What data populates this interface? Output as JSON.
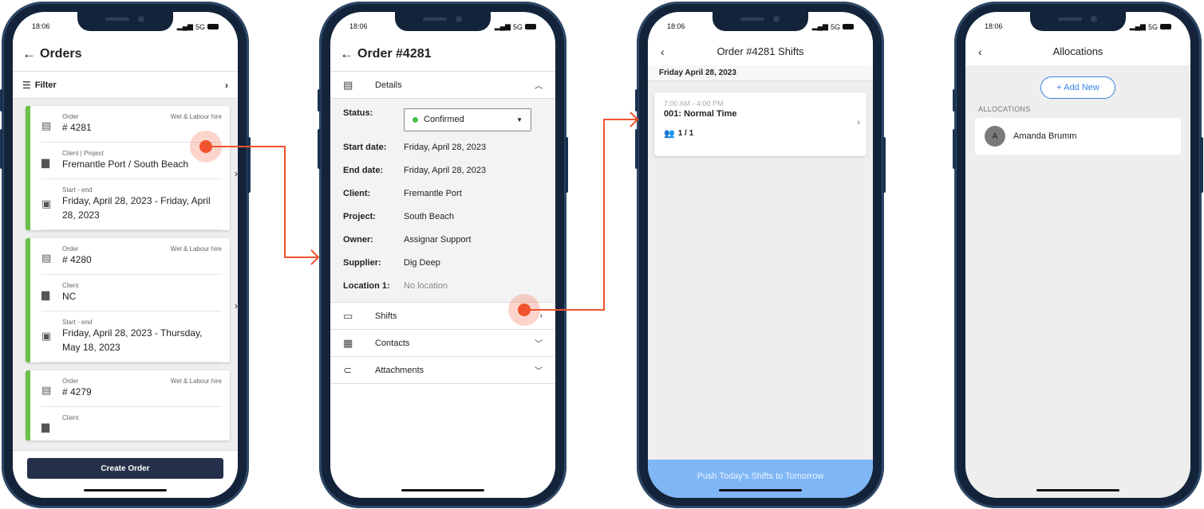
{
  "status": {
    "time": "18:06",
    "network": "5G"
  },
  "screen1": {
    "title": "Orders",
    "filter_label": "Filter",
    "create_button": "Create Order",
    "orders": [
      {
        "order_label": "Order",
        "order_number": "# 4281",
        "type": "Wet & Labour hire",
        "client_label": "Client | Project",
        "client": "Fremantle Port / South Beach",
        "dates_label": "Start - end",
        "dates": "Friday, April 28, 2023 - Friday, April 28, 2023"
      },
      {
        "order_label": "Order",
        "order_number": "# 4280",
        "type": "Wet & Labour hire",
        "client_label": "Client",
        "client": "NC",
        "dates_label": "Start - end",
        "dates": "Friday, April 28, 2023 - Thursday, May 18, 2023"
      },
      {
        "order_label": "Order",
        "order_number": "# 4279",
        "type": "Wet & Labour hire",
        "client_label": "Client",
        "client": "",
        "dates_label": "",
        "dates": ""
      }
    ]
  },
  "screen2": {
    "title": "Order #4281",
    "details_label": "Details",
    "status_key": "Status:",
    "status_value": "Confirmed",
    "fields": [
      {
        "key": "Start date:",
        "value": "Friday, April 28, 2023"
      },
      {
        "key": "End date:",
        "value": "Friday, April 28, 2023"
      },
      {
        "key": "Client:",
        "value": "Fremantle Port"
      },
      {
        "key": "Project:",
        "value": "South Beach"
      },
      {
        "key": "Owner:",
        "value": "Assignar Support"
      },
      {
        "key": "Supplier:",
        "value": "Dig Deep"
      },
      {
        "key": "Location 1:",
        "value": "No location"
      }
    ],
    "sections": {
      "shifts": "Shifts",
      "contacts": "Contacts",
      "attachments": "Attachments"
    }
  },
  "screen3": {
    "title": "Order #4281 Shifts",
    "date": "Friday April 28, 2023",
    "shift": {
      "time": "7:00 AM - 4:00 PM",
      "name": "001: Normal Time",
      "count": "1 / 1"
    },
    "push_button": "Push Today's Shifts to Tomorrow"
  },
  "screen4": {
    "title": "Allocations",
    "add_button": "+ Add New",
    "section_label": "ALLOCATIONS",
    "allocations": [
      {
        "initial": "A",
        "name": "Amanda Brumm"
      }
    ]
  },
  "colors": {
    "accent_green": "#6cc04a",
    "annotation_orange": "#f0532d",
    "primary_blue": "#3b82e4",
    "dark_button": "#25304a"
  }
}
